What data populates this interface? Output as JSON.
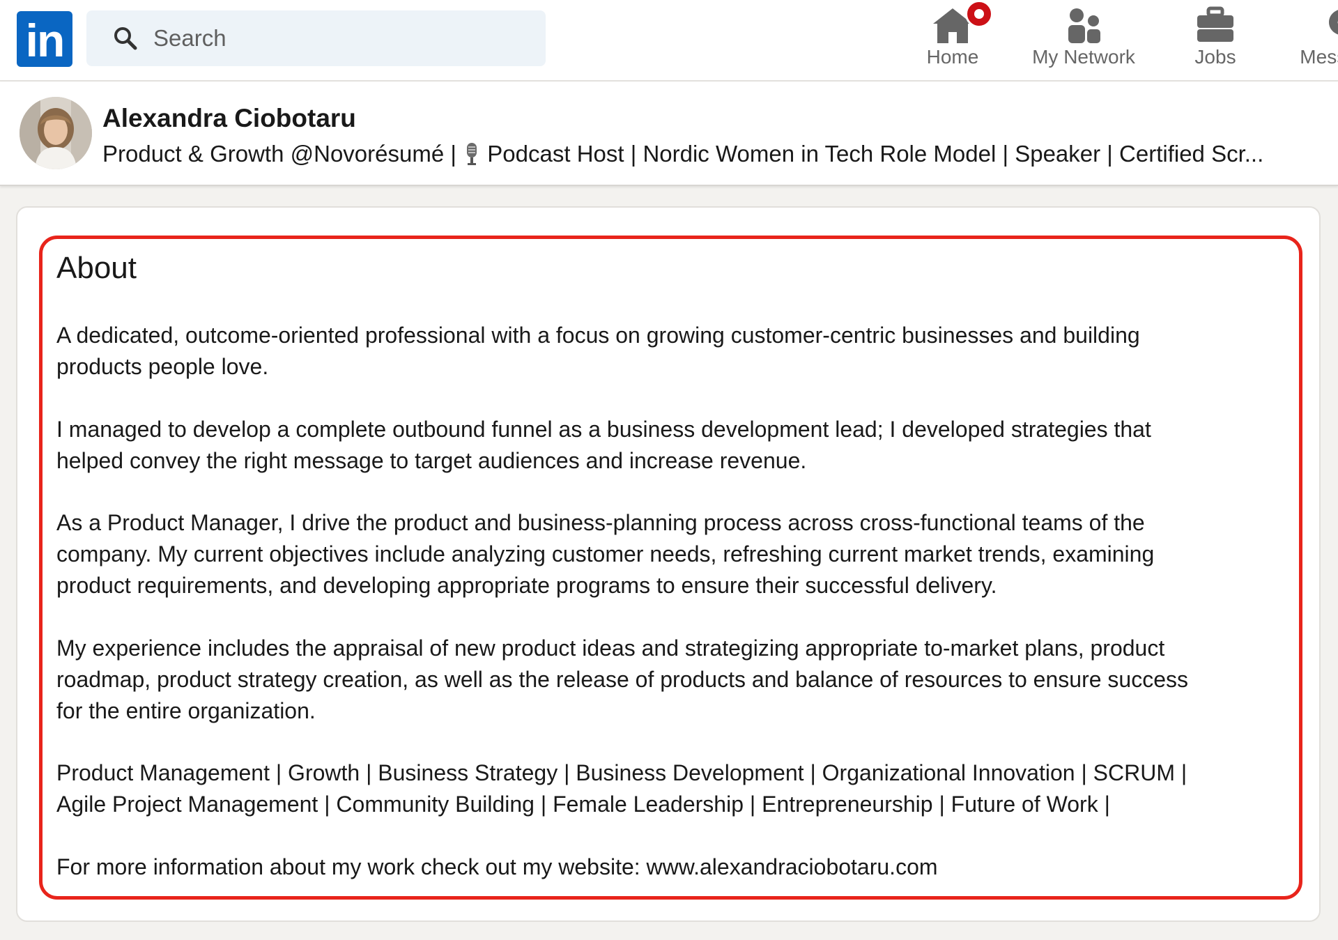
{
  "nav": {
    "search_placeholder": "Search",
    "items": [
      {
        "label": "Home",
        "icon": "home-icon"
      },
      {
        "label": "My Network",
        "icon": "network-icon"
      },
      {
        "label": "Jobs",
        "icon": "briefcase-icon"
      },
      {
        "label": "Messaging",
        "icon": "messaging-icon"
      }
    ]
  },
  "logo": {
    "text": "in"
  },
  "profile": {
    "name": "Alexandra Ciobotaru",
    "headline_part1": "Product & Growth @Novorésumé |",
    "headline_part2": "Podcast Host | Nordic Women in Tech Role Model | Speaker | Certified Scr..."
  },
  "about": {
    "title": "About",
    "paragraphs": [
      [
        "A dedicated, outcome-oriented professional with a focus on growing customer-centric businesses and building",
        "products people love."
      ],
      [
        "I managed to develop a complete outbound funnel as a business development lead; I developed strategies that",
        "helped convey the right message to target audiences and increase revenue."
      ],
      [
        "As a Product Manager, I drive the product and business-planning process across cross-functional teams of the",
        "company. My current objectives include analyzing customer needs, refreshing current market trends, examining",
        "product requirements, and developing appropriate programs to ensure their successful delivery."
      ],
      [
        "My experience includes the appraisal of new product ideas and strategizing appropriate to-market plans, product",
        "roadmap, product strategy creation, as well as the release of products and balance of resources to ensure success",
        "for the entire organization."
      ],
      [
        "Product Management | Growth | Business Strategy | Business Development | Organizational Innovation | SCRUM |",
        "Agile Project Management | Community Building | Female Leadership | Entrepreneurship | Future of Work |"
      ],
      [
        "For more information about my work check out my website: www.alexandraciobotaru.com"
      ]
    ]
  },
  "colors": {
    "brand": "#0a66c2",
    "highlight": "#e8241b",
    "badge": "#cc1016",
    "background": "#f3f2ef"
  }
}
